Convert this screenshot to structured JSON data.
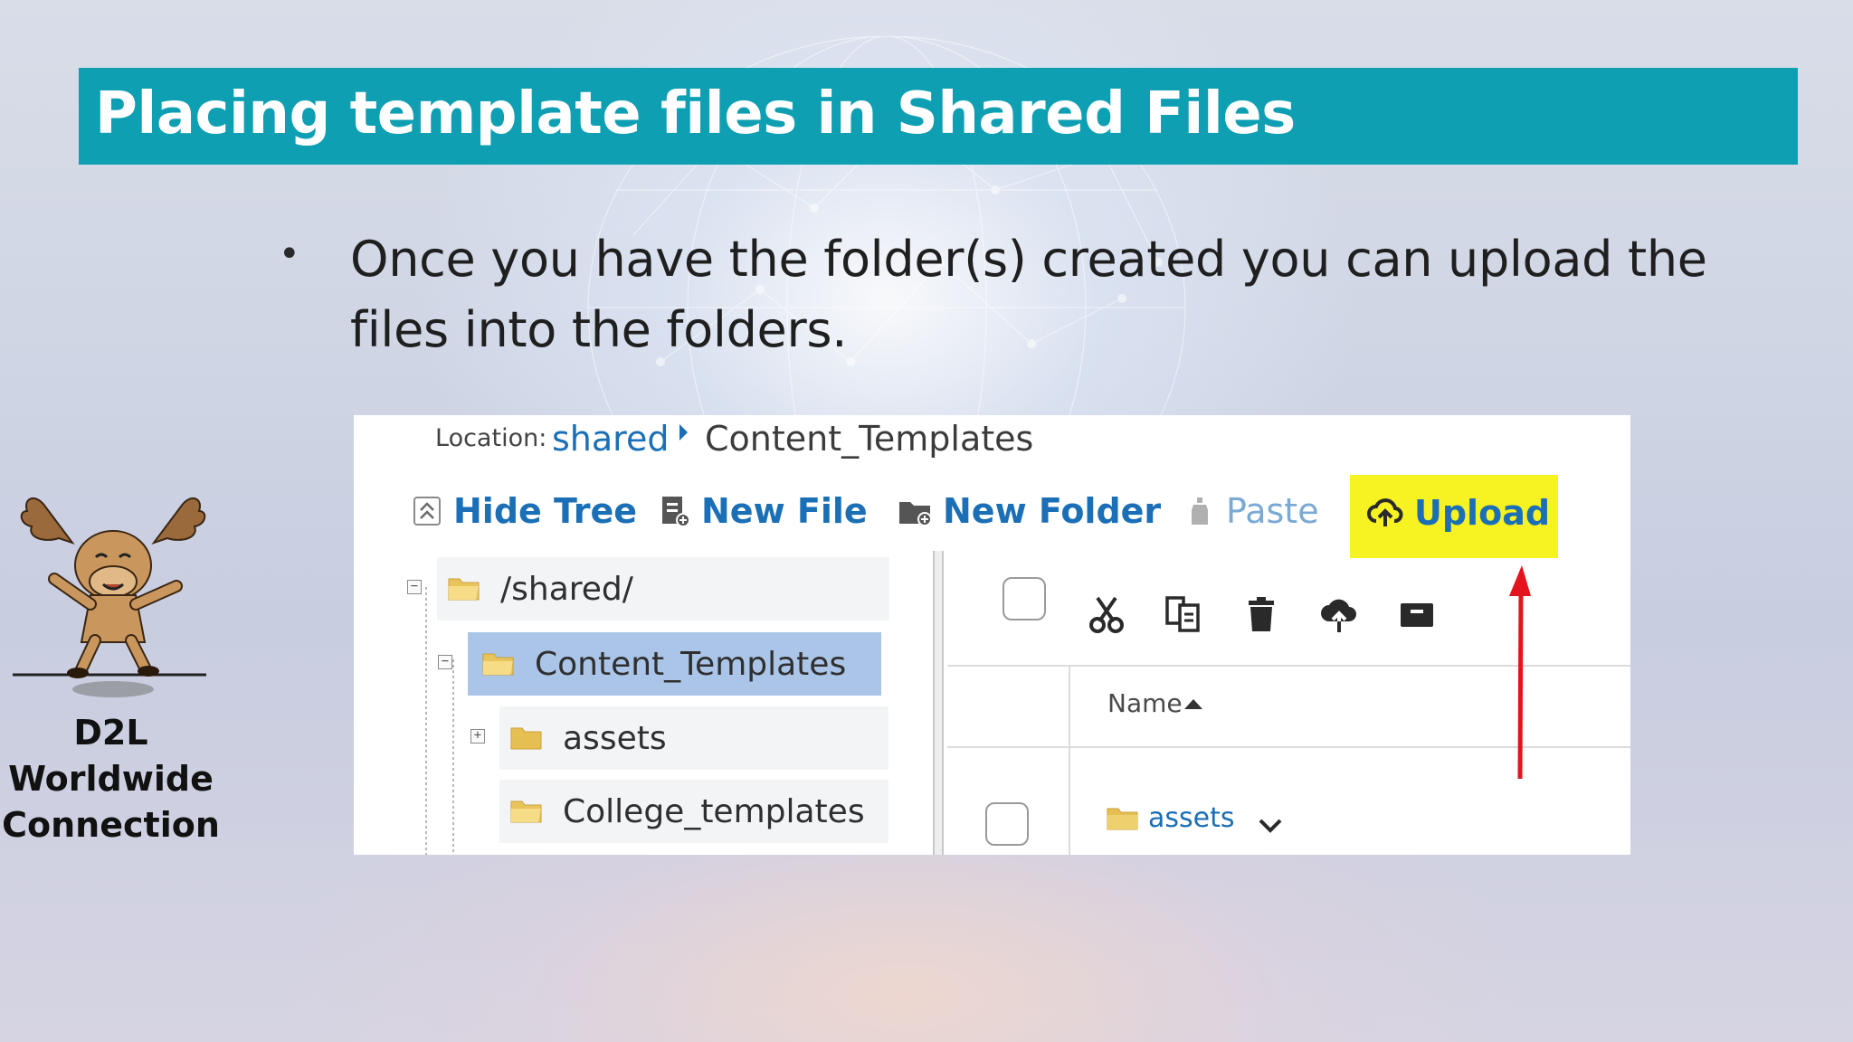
{
  "slide": {
    "title": "Placing template files in Shared Files",
    "bullet": "Once you have the folder(s) created you can upload the files into the folders.",
    "brand": [
      "D2L",
      "Worldwide",
      "Connection"
    ]
  },
  "screenshot": {
    "location_label": "Location:",
    "location_root": "shared",
    "location_current": "Content_Templates",
    "toolbar": {
      "hide_tree": "Hide Tree",
      "new_file": "New File",
      "new_folder": "New Folder",
      "paste": "Paste",
      "upload": "Upload"
    },
    "tree": [
      {
        "label": "/shared/",
        "toggle": "−"
      },
      {
        "label": "Content_Templates",
        "toggle": "−",
        "selected": true
      },
      {
        "label": "assets",
        "toggle": "+"
      },
      {
        "label": "College_templates"
      }
    ],
    "grid": {
      "name_header": "Name",
      "rows": [
        {
          "name": "assets"
        }
      ]
    }
  },
  "colors": {
    "title_bar": "#0f9fb3",
    "link_blue": "#1a6fb6",
    "upload_highlight": "#f7f221",
    "selected_row": "#aac5e8",
    "arrow_red": "#e3141b"
  }
}
